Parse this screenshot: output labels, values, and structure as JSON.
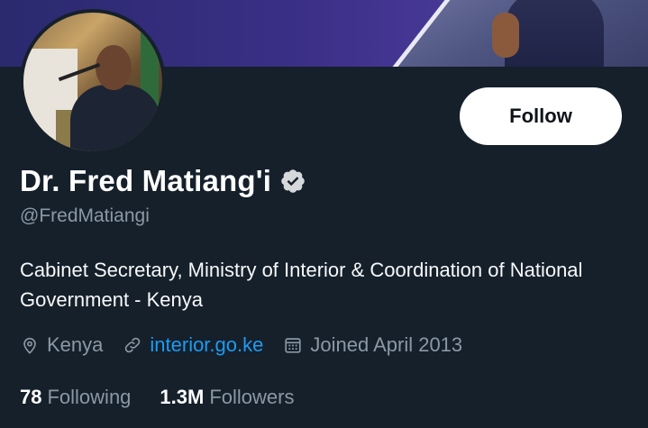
{
  "profile": {
    "name": "Dr. Fred Matiang'i",
    "handle": "@FredMatiangi",
    "bio": "Cabinet Secretary, Ministry of Interior & Coordination of National Government - Kenya",
    "verified": true,
    "location": "Kenya",
    "website": "interior.go.ke",
    "joined": "Joined April 2013",
    "follow_label": "Follow",
    "following_count": "78",
    "following_label": "Following",
    "followers_count": "1.3M",
    "followers_label": "Followers"
  },
  "icons": {
    "verified": "verified-badge-icon",
    "location": "location-pin-icon",
    "link": "link-icon",
    "calendar": "calendar-icon"
  },
  "colors": {
    "background": "#15202b",
    "accent_link": "#1d9bf0",
    "secondary_text": "#8b98a5",
    "follow_button_bg": "#ffffff"
  }
}
